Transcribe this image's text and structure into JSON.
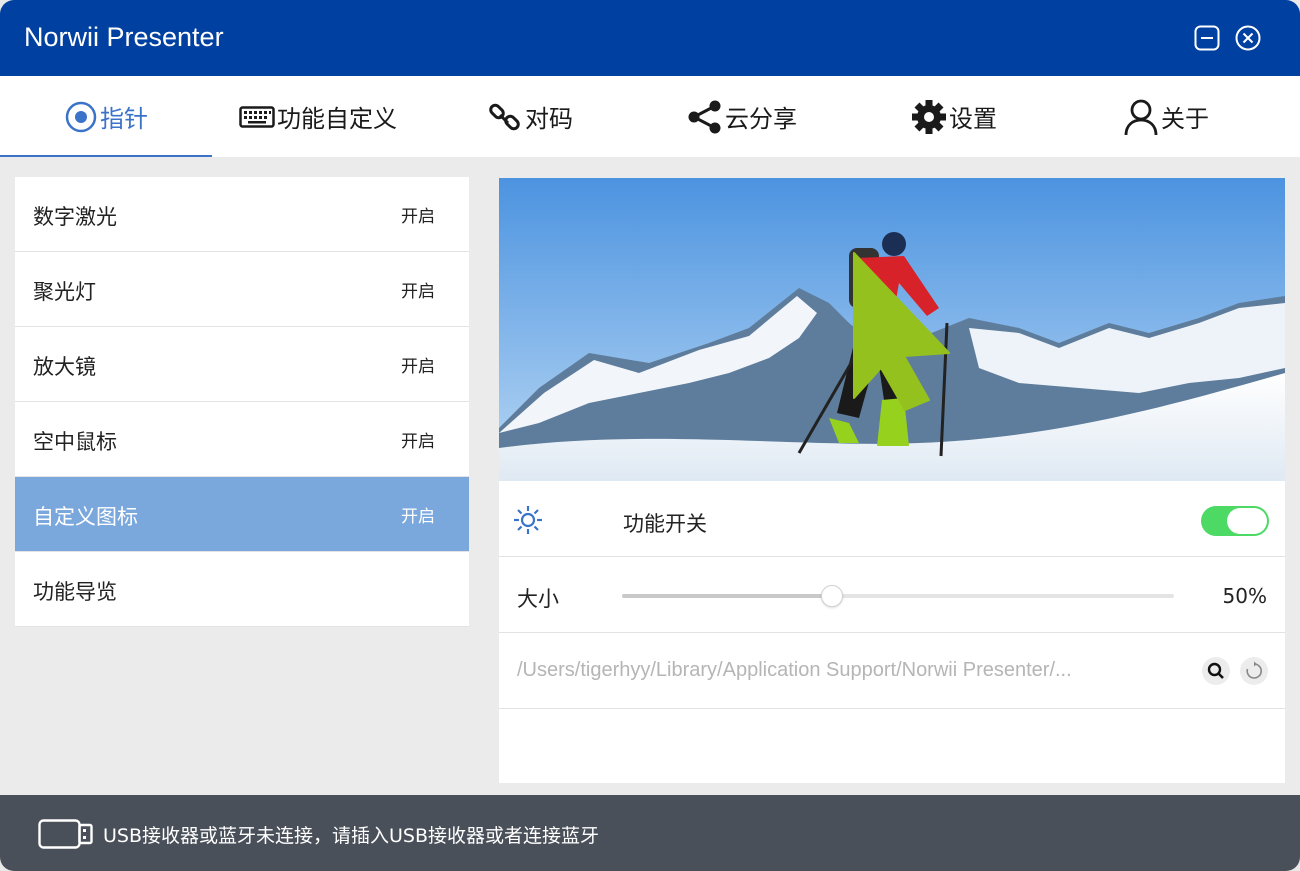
{
  "window": {
    "title": "Norwii Presenter"
  },
  "tabs": [
    {
      "label": "指针",
      "icon": "target-icon",
      "active": true
    },
    {
      "label": "功能自定义",
      "icon": "keyboard-icon"
    },
    {
      "label": "对码",
      "icon": "link-icon"
    },
    {
      "label": "云分享",
      "icon": "share-icon"
    },
    {
      "label": "设置",
      "icon": "gear-icon"
    },
    {
      "label": "关于",
      "icon": "user-icon"
    }
  ],
  "features": [
    {
      "label": "数字激光",
      "status": "开启"
    },
    {
      "label": "聚光灯",
      "status": "开启"
    },
    {
      "label": "放大镜",
      "status": "开启"
    },
    {
      "label": "空中鼠标",
      "status": "开启"
    },
    {
      "label": "自定义图标",
      "status": "开启",
      "selected": true
    },
    {
      "label": "功能导览",
      "status": ""
    }
  ],
  "detail": {
    "switch_label": "功能开关",
    "switch_on": true,
    "size_label": "大小",
    "size_percent": 50,
    "size_value": "50%",
    "path": "/Users/tigerhyy/Library/Application Support/Norwii Presenter/..."
  },
  "status_bar": {
    "message": "USB接收器或蓝牙未连接，请插入USB接收器或者连接蓝牙"
  },
  "colors": {
    "titlebar": "#0040a0",
    "accent": "#3b73c9",
    "selected": "#7aa8dd",
    "toggle_on": "#4cd964",
    "statusbar": "#4a5059",
    "cursor": "#95c11f"
  }
}
